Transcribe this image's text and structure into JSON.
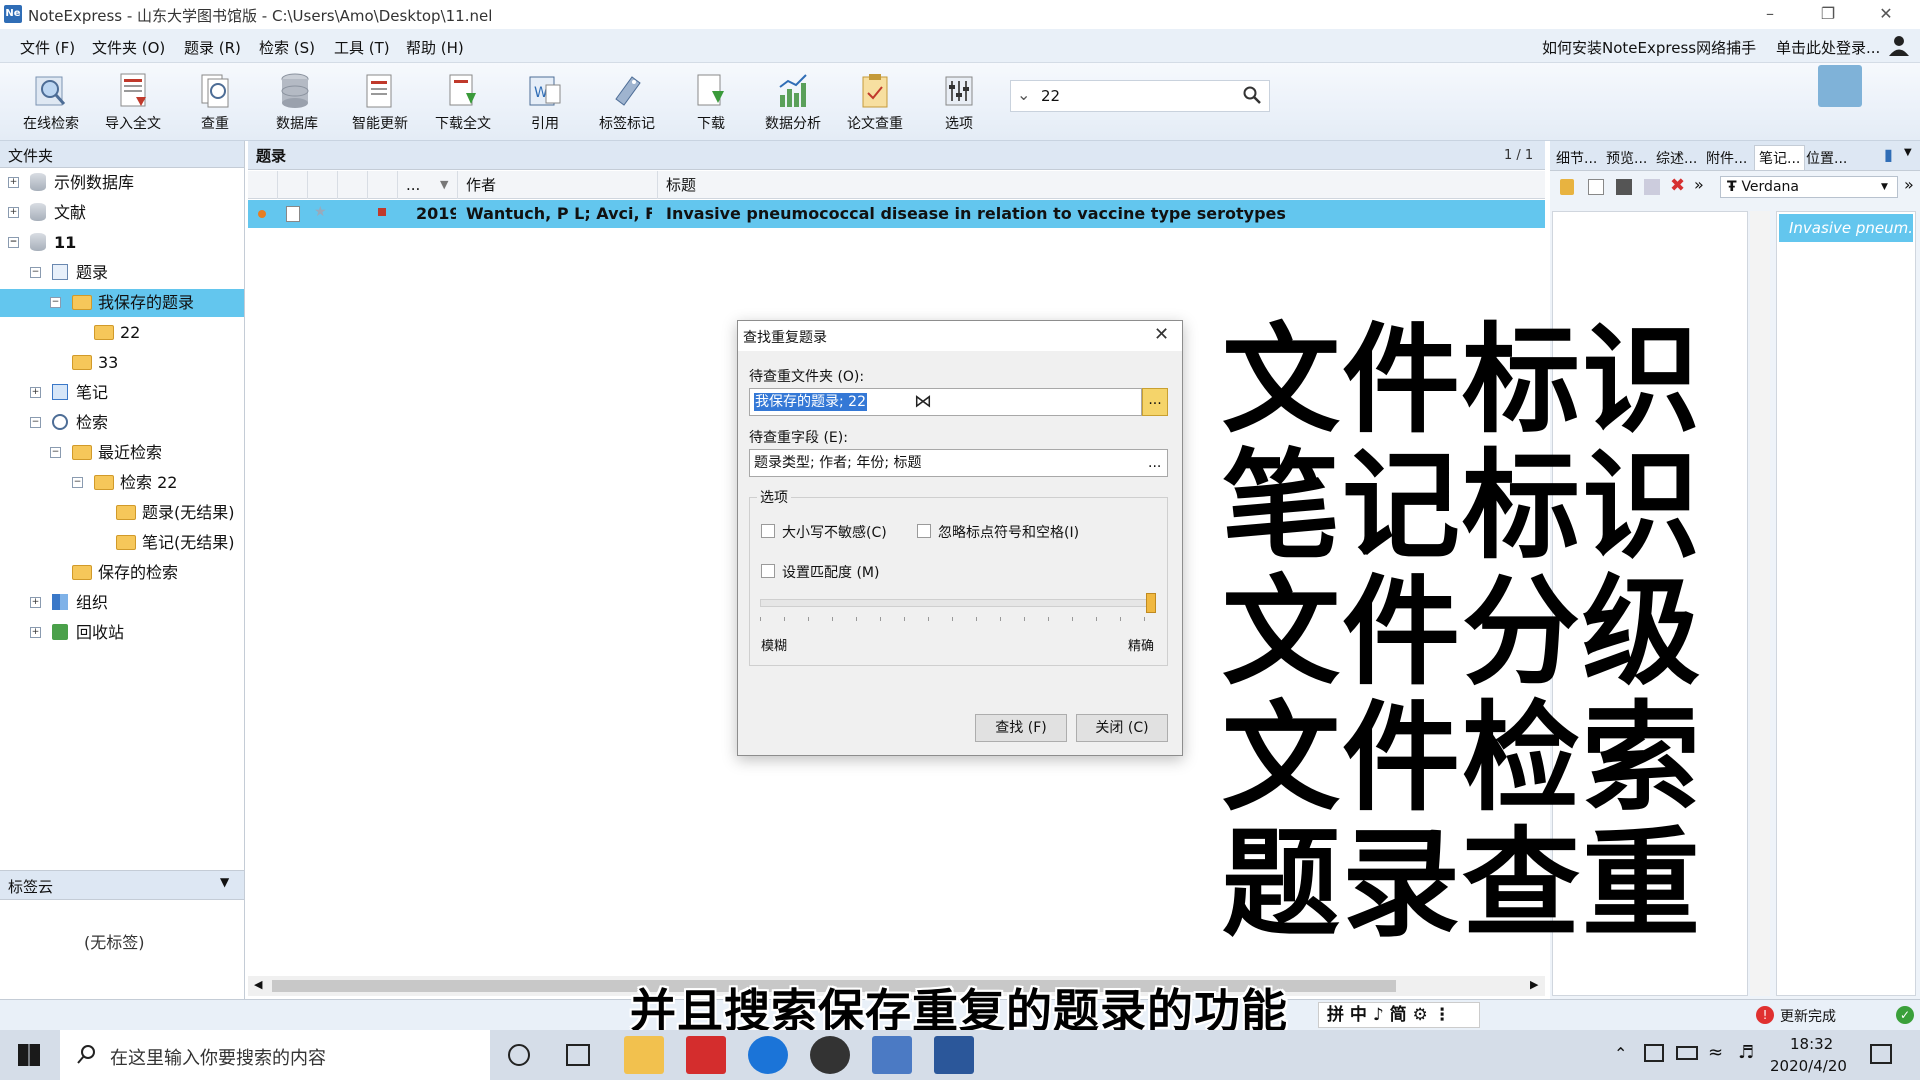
{
  "window": {
    "title": "NoteExpress - 山东大学图书馆版 - C:\\Users\\Amo\\Desktop\\11.nel",
    "app_icon": "Ne"
  },
  "menu": [
    "文件 (F)",
    "文件夹 (O)",
    "题录 (R)",
    "检索 (S)",
    "工具 (T)",
    "帮助 (H)"
  ],
  "menu_right": {
    "network": "如何安装NoteExpress网络捕手",
    "login": "单击此处登录..."
  },
  "toolbar": [
    "在线检索",
    "导入全文",
    "查重",
    "数据库",
    "智能更新",
    "下载全文",
    "引用",
    "标签标记",
    "下载",
    "数据分析",
    "论文查重",
    "选项"
  ],
  "search": {
    "value": "22"
  },
  "left_pane": {
    "header": "文件夹",
    "tree": [
      "示例数据库",
      "文献",
      "11",
      "题录",
      "我保存的题录",
      "22",
      "33",
      "笔记",
      "检索",
      "最近检索",
      "检索 22",
      "题录(无结果)",
      "笔记(无结果)",
      "保存的检索",
      "组织",
      "回收站"
    ],
    "tag_cloud_header": "标签云",
    "tag_cloud_empty": "(无标签)"
  },
  "center": {
    "title": "题录",
    "page": "1 / 1",
    "columns": [
      "...",
      "作者",
      "标题"
    ],
    "row": {
      "year": "2019",
      "author": "Wantuch, P L; Avci, F Y",
      "title": "Invasive pneumococcal disease in relation to vaccine type serotypes"
    }
  },
  "right_pane": {
    "tabs": [
      "细节...",
      "预览...",
      "综述...",
      "附件...",
      "笔记...",
      "位置..."
    ],
    "font": "Verdana",
    "note_item": "Invasive pneum..."
  },
  "dialog": {
    "title": "查找重复题录",
    "folder_label": "待查重文件夹 (O):",
    "folder_value": "我保存的题录; 22",
    "field_label": "待查重字段 (E):",
    "field_value": "题录类型; 作者; 年份; 标题",
    "options_label": "选项",
    "case_label": "大小写不敏感(C)",
    "ignore_label": "忽略标点符号和空格(I)",
    "match_label": "设置匹配度 (M)",
    "fuzzy_label": "模糊",
    "exact_label": "精确",
    "find_button": "查找 (F)",
    "close_button": "关闭 (C)"
  },
  "overlay_text": [
    "文件标识",
    "笔记标识",
    "文件分级",
    "文件检索",
    "题录查重"
  ],
  "subtitle": "并且搜索保存重复的题录的功能",
  "status": {
    "update": "更新完成",
    "ime": "拼 中 ♪ 简 ⚙ ⋮"
  },
  "taskbar": {
    "search_placeholder": "在这里输入你要搜索的内容",
    "time": "18:32",
    "date": "2020/4/20"
  },
  "colors": {
    "selection": "#63c6ee",
    "accent": "#2f6db6",
    "folder": "#f6c75a"
  }
}
